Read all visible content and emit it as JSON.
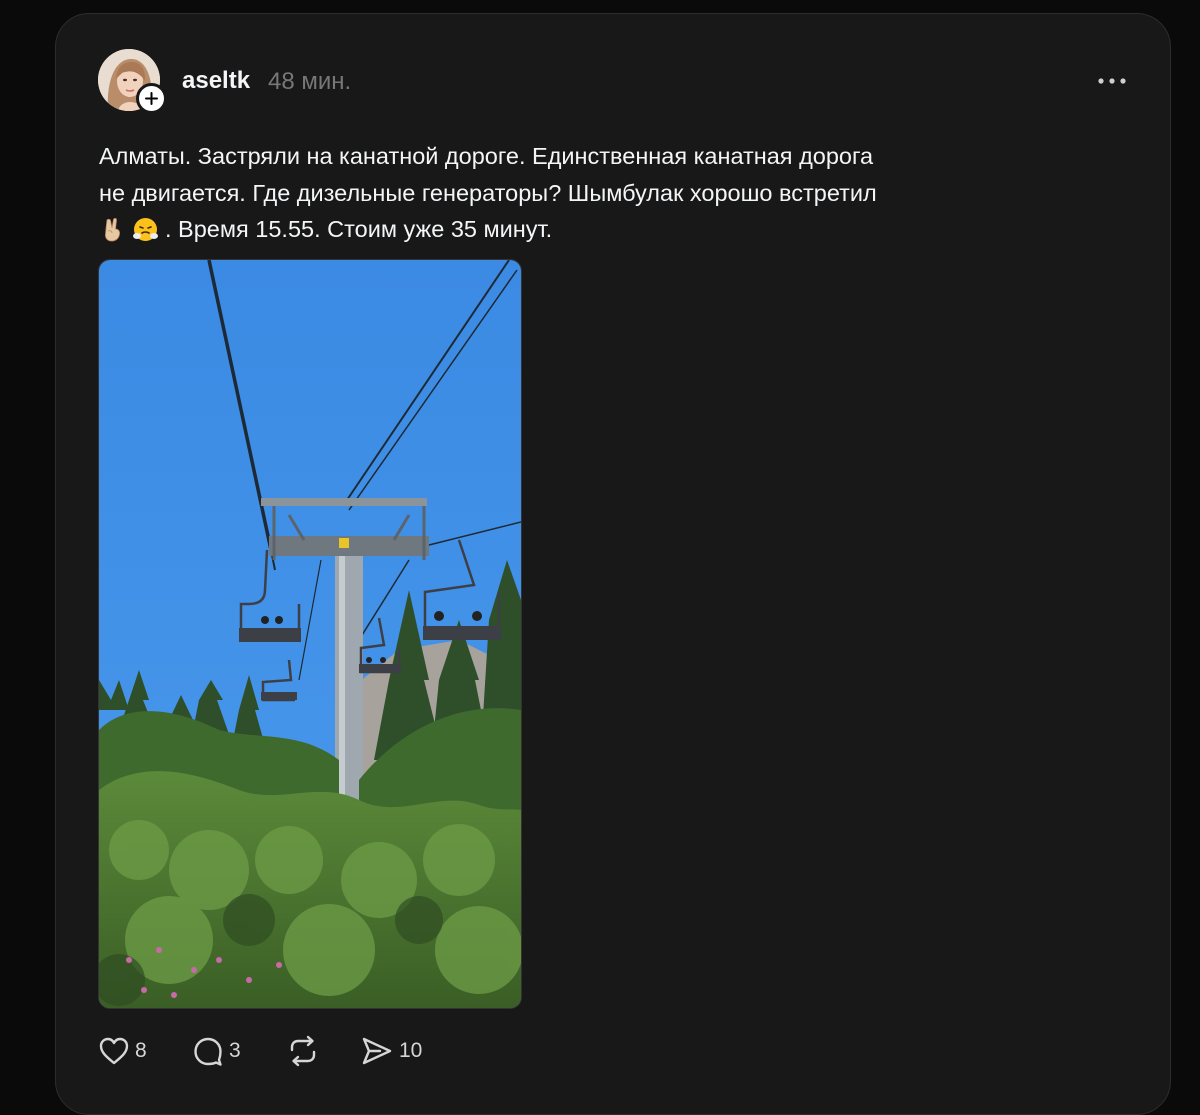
{
  "post": {
    "author": {
      "username": "aseltk",
      "avatar_icon": "user-photo",
      "follow_icon": "plus-icon"
    },
    "timestamp": "48 мин.",
    "more_icon": "more-horizontal-icon",
    "text_lines": [
      "Алматы. Застряли на канатной дороге. Единственная канатная дорога",
      "не двигается. Где дизельные генераторы? Шымбулак хорошо встретил",
      ". Время 15.55. Стоим уже 35 минут."
    ],
    "emojis": [
      "✌🏼",
      "😤"
    ],
    "media": {
      "type": "photo",
      "subject": "ski chairlift stopped over green forest under blue sky"
    },
    "actions": {
      "like": {
        "icon": "heart-icon",
        "count": "8"
      },
      "comment": {
        "icon": "comment-bubble-icon",
        "count": "3"
      },
      "repost": {
        "icon": "repost-icon"
      },
      "share": {
        "icon": "send-icon",
        "count": "10"
      }
    }
  },
  "colors": {
    "page_background": "#0a0a0a",
    "card_background": "#181818",
    "primary_text": "#f3f5f7",
    "secondary_text": "#777777",
    "sky": "#3f8fe6",
    "foliage": "#4f7a34"
  }
}
